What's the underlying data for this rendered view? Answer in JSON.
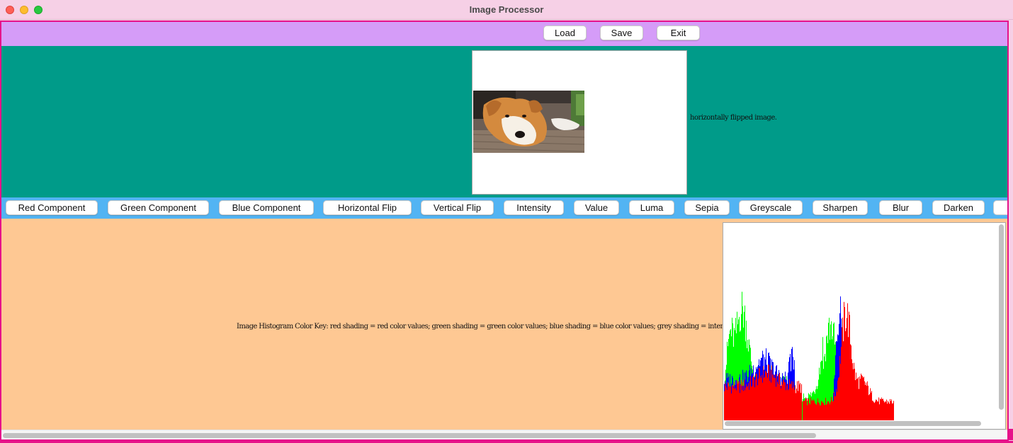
{
  "window": {
    "title": "Image Processor",
    "accent_color": "#e6128a"
  },
  "toolbar": {
    "load_label": "Load",
    "save_label": "Save",
    "exit_label": "Exit",
    "background": "#d59cf8"
  },
  "image_panel": {
    "background": "#009b89",
    "caption": "horizontally flipped image."
  },
  "operations": {
    "background": "#52b4f3",
    "buttons": [
      "Red Component",
      "Green Component",
      "Blue Component",
      "Horizontal Flip",
      "Vertical Flip",
      "Intensity",
      "Value",
      "Luma",
      "Sepia",
      "Greyscale",
      "Sharpen",
      "Blur",
      "Darken"
    ]
  },
  "histogram": {
    "background": "#fec893",
    "key_text": "Image Histogram Color Key: red shading = red color values; green shading = green color values; blue shading = blue color values; grey shading = intensity values",
    "colors": {
      "red": "#ff0000",
      "green": "#00ff00",
      "blue": "#0000ff",
      "grey": "#888888"
    }
  }
}
